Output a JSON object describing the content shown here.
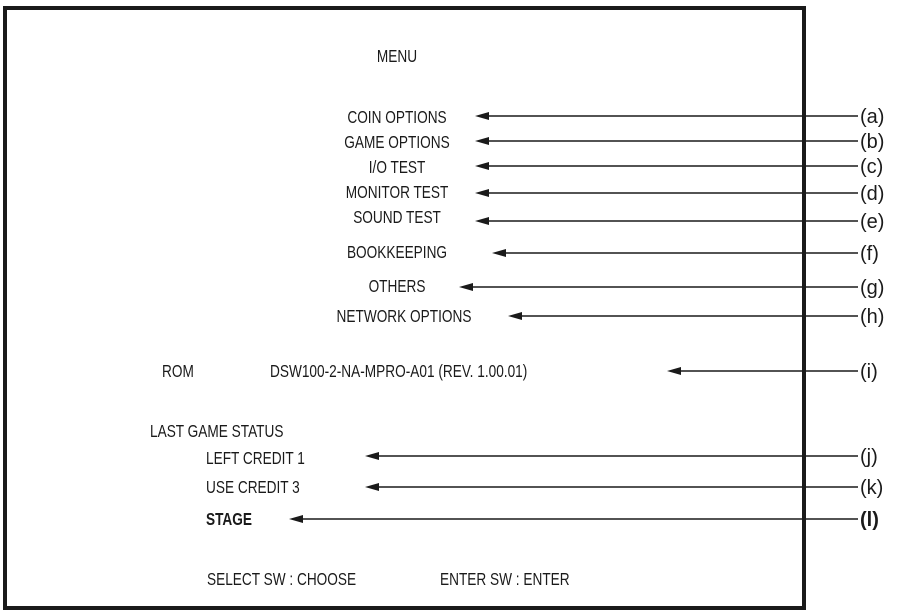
{
  "screen": {
    "title": "MENU",
    "menu_items": [
      {
        "label": "COIN OPTIONS",
        "callout": "a"
      },
      {
        "label": "GAME OPTIONS",
        "callout": "b"
      },
      {
        "label": "I/O TEST",
        "callout": "c"
      },
      {
        "label": "MONITOR TEST",
        "callout": "d"
      },
      {
        "label": "SOUND TEST",
        "callout": "e"
      },
      {
        "label": "BOOKKEEPING",
        "callout": "f"
      },
      {
        "label": "OTHERS",
        "callout": "g"
      },
      {
        "label": "NETWORK OPTIONS",
        "callout": "h"
      }
    ],
    "rom": {
      "label": "ROM",
      "value": "DSW100-2-NA-MPRO-A01 (REV. 1.00.01)",
      "callout": "i"
    },
    "last_game_status": {
      "heading": "LAST GAME STATUS",
      "items": [
        {
          "label": "LEFT CREDIT 1",
          "callout": "j",
          "bold": false
        },
        {
          "label": "USE CREDIT  3",
          "callout": "k",
          "bold": false
        },
        {
          "label": "STAGE",
          "callout": "l",
          "bold": true
        }
      ]
    },
    "footer": {
      "select": "SELECT SW : CHOOSE",
      "enter": "ENTER SW : ENTER"
    }
  },
  "callout_labels": [
    "(a)",
    "(b)",
    "(c)",
    "(d)",
    "(e)",
    "(f)",
    "(g)",
    "(h)",
    "(i)",
    "(j)",
    "(k)",
    "(l)"
  ]
}
